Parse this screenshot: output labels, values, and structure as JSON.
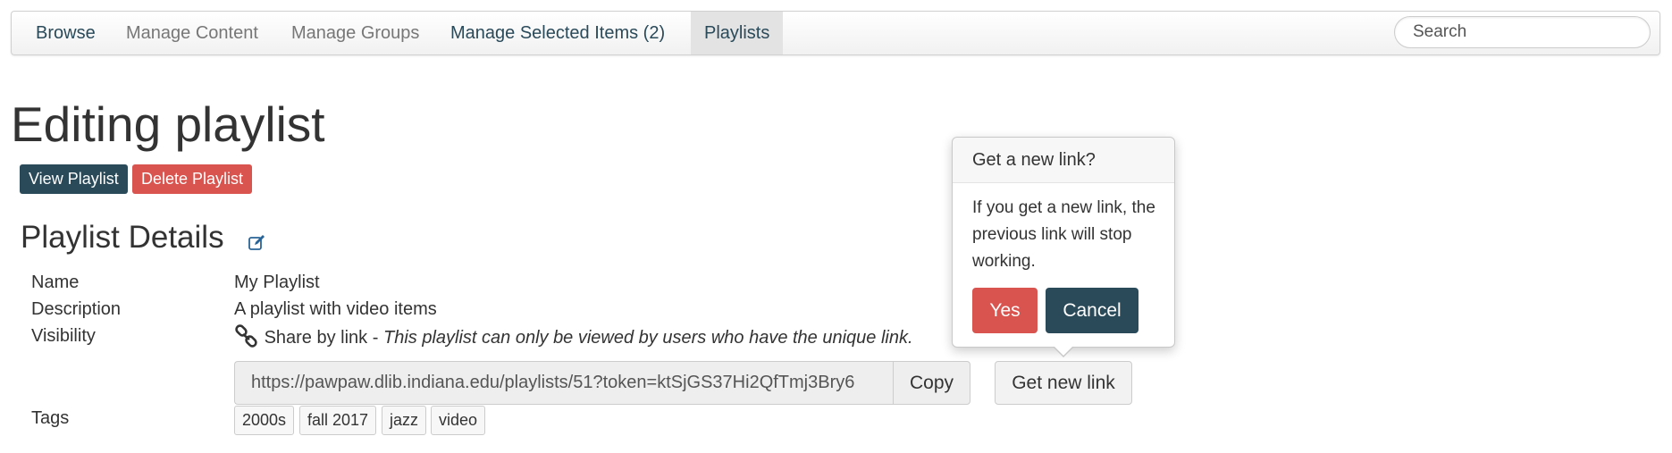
{
  "nav": {
    "items": [
      {
        "label": "Browse"
      },
      {
        "label": "Manage Content"
      },
      {
        "label": "Manage Groups"
      },
      {
        "label": "Manage Selected Items (2)"
      },
      {
        "label": "Playlists",
        "active": true
      }
    ],
    "search_placeholder": "Search"
  },
  "page": {
    "title": "Editing playlist",
    "view_button": "View Playlist",
    "delete_button": "Delete Playlist"
  },
  "details": {
    "section_title": "Playlist Details",
    "name_label": "Name",
    "name_value": "My Playlist",
    "description_label": "Description",
    "description_value": "A playlist with video items",
    "visibility_label": "Visibility",
    "visibility_value": "Share by link",
    "visibility_separator": "-",
    "visibility_note": "This playlist can only be viewed by users who have the unique link.",
    "share_url": "https://pawpaw.dlib.indiana.edu/playlists/51?token=ktSjGS37Hi2QfTmj3Bry6",
    "copy_button": "Copy",
    "get_new_link_button": "Get new link",
    "tags_label": "Tags",
    "tags": [
      "2000s",
      "fall 2017",
      "jazz",
      "video"
    ]
  },
  "popover": {
    "title": "Get a new link?",
    "body": "If you get a new link, the previous link will stop working.",
    "yes_button": "Yes",
    "cancel_button": "Cancel"
  },
  "colors": {
    "primary": "#2a4a5a",
    "danger": "#d9534f",
    "link_icon": "#2a6496"
  },
  "icons": {
    "edit": "edit-icon",
    "share_link": "link-icon"
  }
}
